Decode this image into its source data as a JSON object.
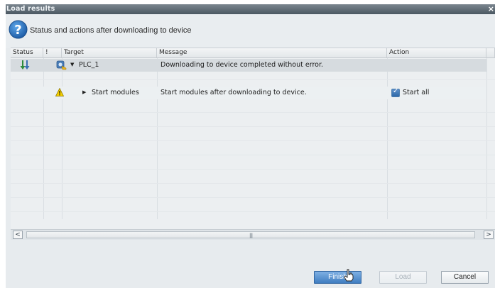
{
  "window": {
    "title": "Load results",
    "close_glyph": "×"
  },
  "header": {
    "icon": "question-mark-icon",
    "text": "Status and actions after downloading to device"
  },
  "table": {
    "columns": [
      "Status",
      "!",
      "Target",
      "Message",
      "Action"
    ],
    "rows": [
      {
        "status_icon": "download-arrows-icon",
        "flag_icon": "online-device-icon",
        "target": "PLC_1",
        "expanded": true,
        "message": "Downloading to device completed without error.",
        "action": ""
      },
      {
        "status_icon": "",
        "flag_icon": "warning-icon",
        "target": "Start modules",
        "expanded": false,
        "message": "Start modules after downloading to device.",
        "action": "Start all",
        "action_checked": true
      }
    ]
  },
  "scrollbar": {
    "left_glyph": "<",
    "right_glyph": ">",
    "grip_glyph": "|||"
  },
  "buttons": {
    "finish": "Finish",
    "load": "Load",
    "cancel": "Cancel"
  },
  "colors": {
    "title_bar": "#4b5862",
    "primary_button": "#3f7dc1",
    "checkbox": "#2e68a8",
    "warning": "#f5d000"
  }
}
